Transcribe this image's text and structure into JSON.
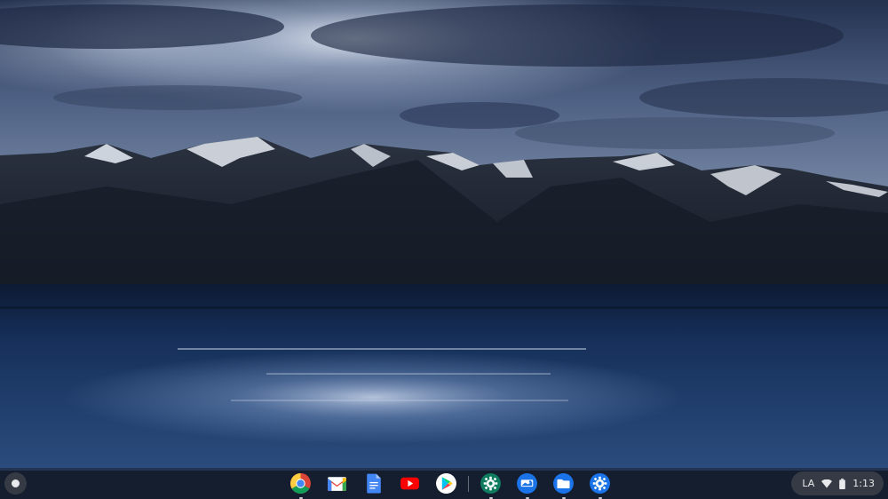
{
  "desktop": {
    "wallpaper": {
      "sky_top": "#2c3b5c",
      "sky_glow": "#dfe7f3",
      "mountain": "#1b2230",
      "snow": "#e6ebf2",
      "lake": "#1a3660",
      "lake_reflection": "#a9bfe0"
    }
  },
  "shelf": {
    "launcher_icon": "launcher-circle-icon",
    "apps": [
      {
        "name": "chrome",
        "icon": "chrome-icon",
        "running": true
      },
      {
        "name": "gmail",
        "icon": "gmail-icon",
        "running": false
      },
      {
        "name": "docs",
        "icon": "docs-icon",
        "running": false
      },
      {
        "name": "youtube",
        "icon": "youtube-icon",
        "running": false
      },
      {
        "name": "play-store",
        "icon": "play-store-icon",
        "running": false
      },
      {
        "name": "settings-android",
        "icon": "android-settings-icon",
        "running": true
      },
      {
        "name": "screencast",
        "icon": "screencast-icon",
        "running": true
      },
      {
        "name": "files",
        "icon": "files-icon",
        "running": true
      },
      {
        "name": "settings",
        "icon": "settings-icon",
        "running": true
      }
    ]
  },
  "status_tray": {
    "ime_label": "LA",
    "wifi_icon": "wifi-icon",
    "battery_icon": "battery-icon",
    "time": "1:13"
  }
}
